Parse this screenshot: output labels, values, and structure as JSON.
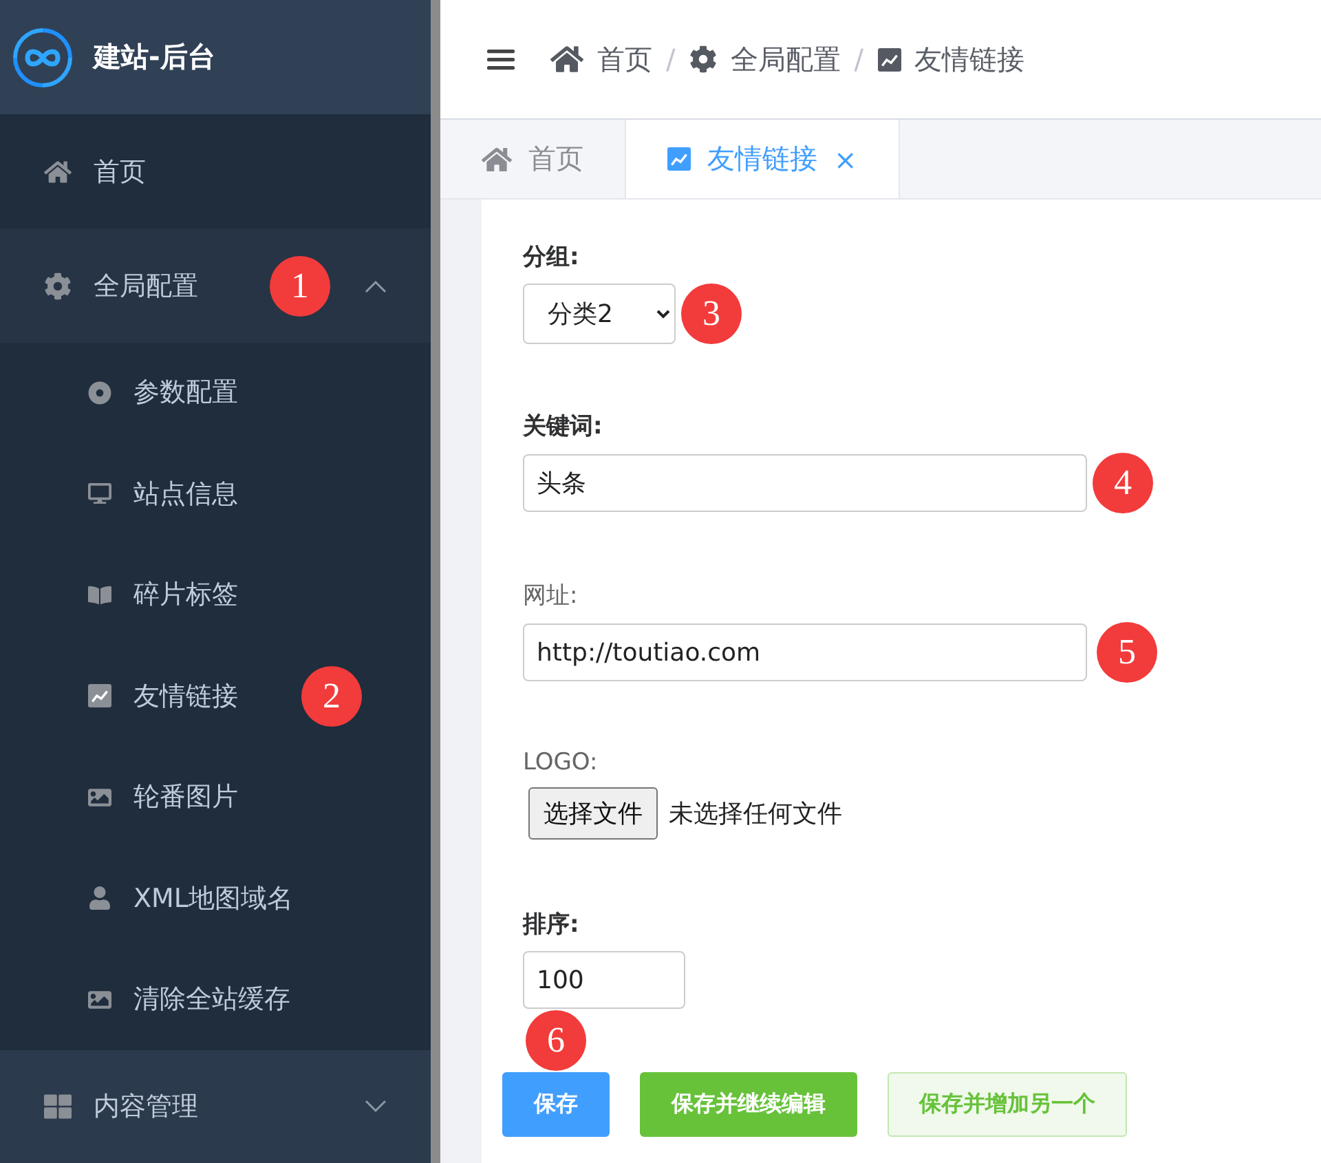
{
  "brand": {
    "title": "建站-后台"
  },
  "sidebar": {
    "items": [
      {
        "label": "首页"
      },
      {
        "label": "全局配置",
        "expanded": true,
        "badge": "1",
        "children": [
          {
            "label": "参数配置"
          },
          {
            "label": "站点信息"
          },
          {
            "label": "碎片标签"
          },
          {
            "label": "友情链接",
            "badge": "2"
          },
          {
            "label": "轮番图片"
          },
          {
            "label": "XML地图域名"
          },
          {
            "label": "清除全站缓存"
          }
        ]
      },
      {
        "label": "内容管理",
        "expanded": false
      }
    ]
  },
  "breadcrumb": [
    {
      "label": "首页"
    },
    {
      "label": "全局配置"
    },
    {
      "label": "友情链接"
    }
  ],
  "breadcrumb_separator": "/",
  "tabs": [
    {
      "label": "首页",
      "selected": false
    },
    {
      "label": "友情链接",
      "selected": true,
      "close": "×"
    }
  ],
  "form": {
    "fields": [
      {
        "kind": "select",
        "label": "分组:",
        "emphasized": true,
        "value": "分类2",
        "badge": "3"
      },
      {
        "kind": "text",
        "label": "关键词:",
        "emphasized": true,
        "value": "头条",
        "badge": "4"
      },
      {
        "kind": "text",
        "label": "网址:",
        "emphasized": false,
        "value": "http://toutiao.com",
        "badge": "5"
      },
      {
        "kind": "file",
        "label": "LOGO:",
        "emphasized": false,
        "button": "选择文件",
        "status": "未选择任何文件"
      },
      {
        "kind": "number",
        "label": "排序:",
        "emphasized": true,
        "value": "100"
      }
    ]
  },
  "buttons": [
    {
      "label": "保存",
      "kind": "primary",
      "badge": "6"
    },
    {
      "label": "保存并继续编辑",
      "kind": "success"
    },
    {
      "label": "保存并增加另一个",
      "kind": "plain-success"
    }
  ]
}
